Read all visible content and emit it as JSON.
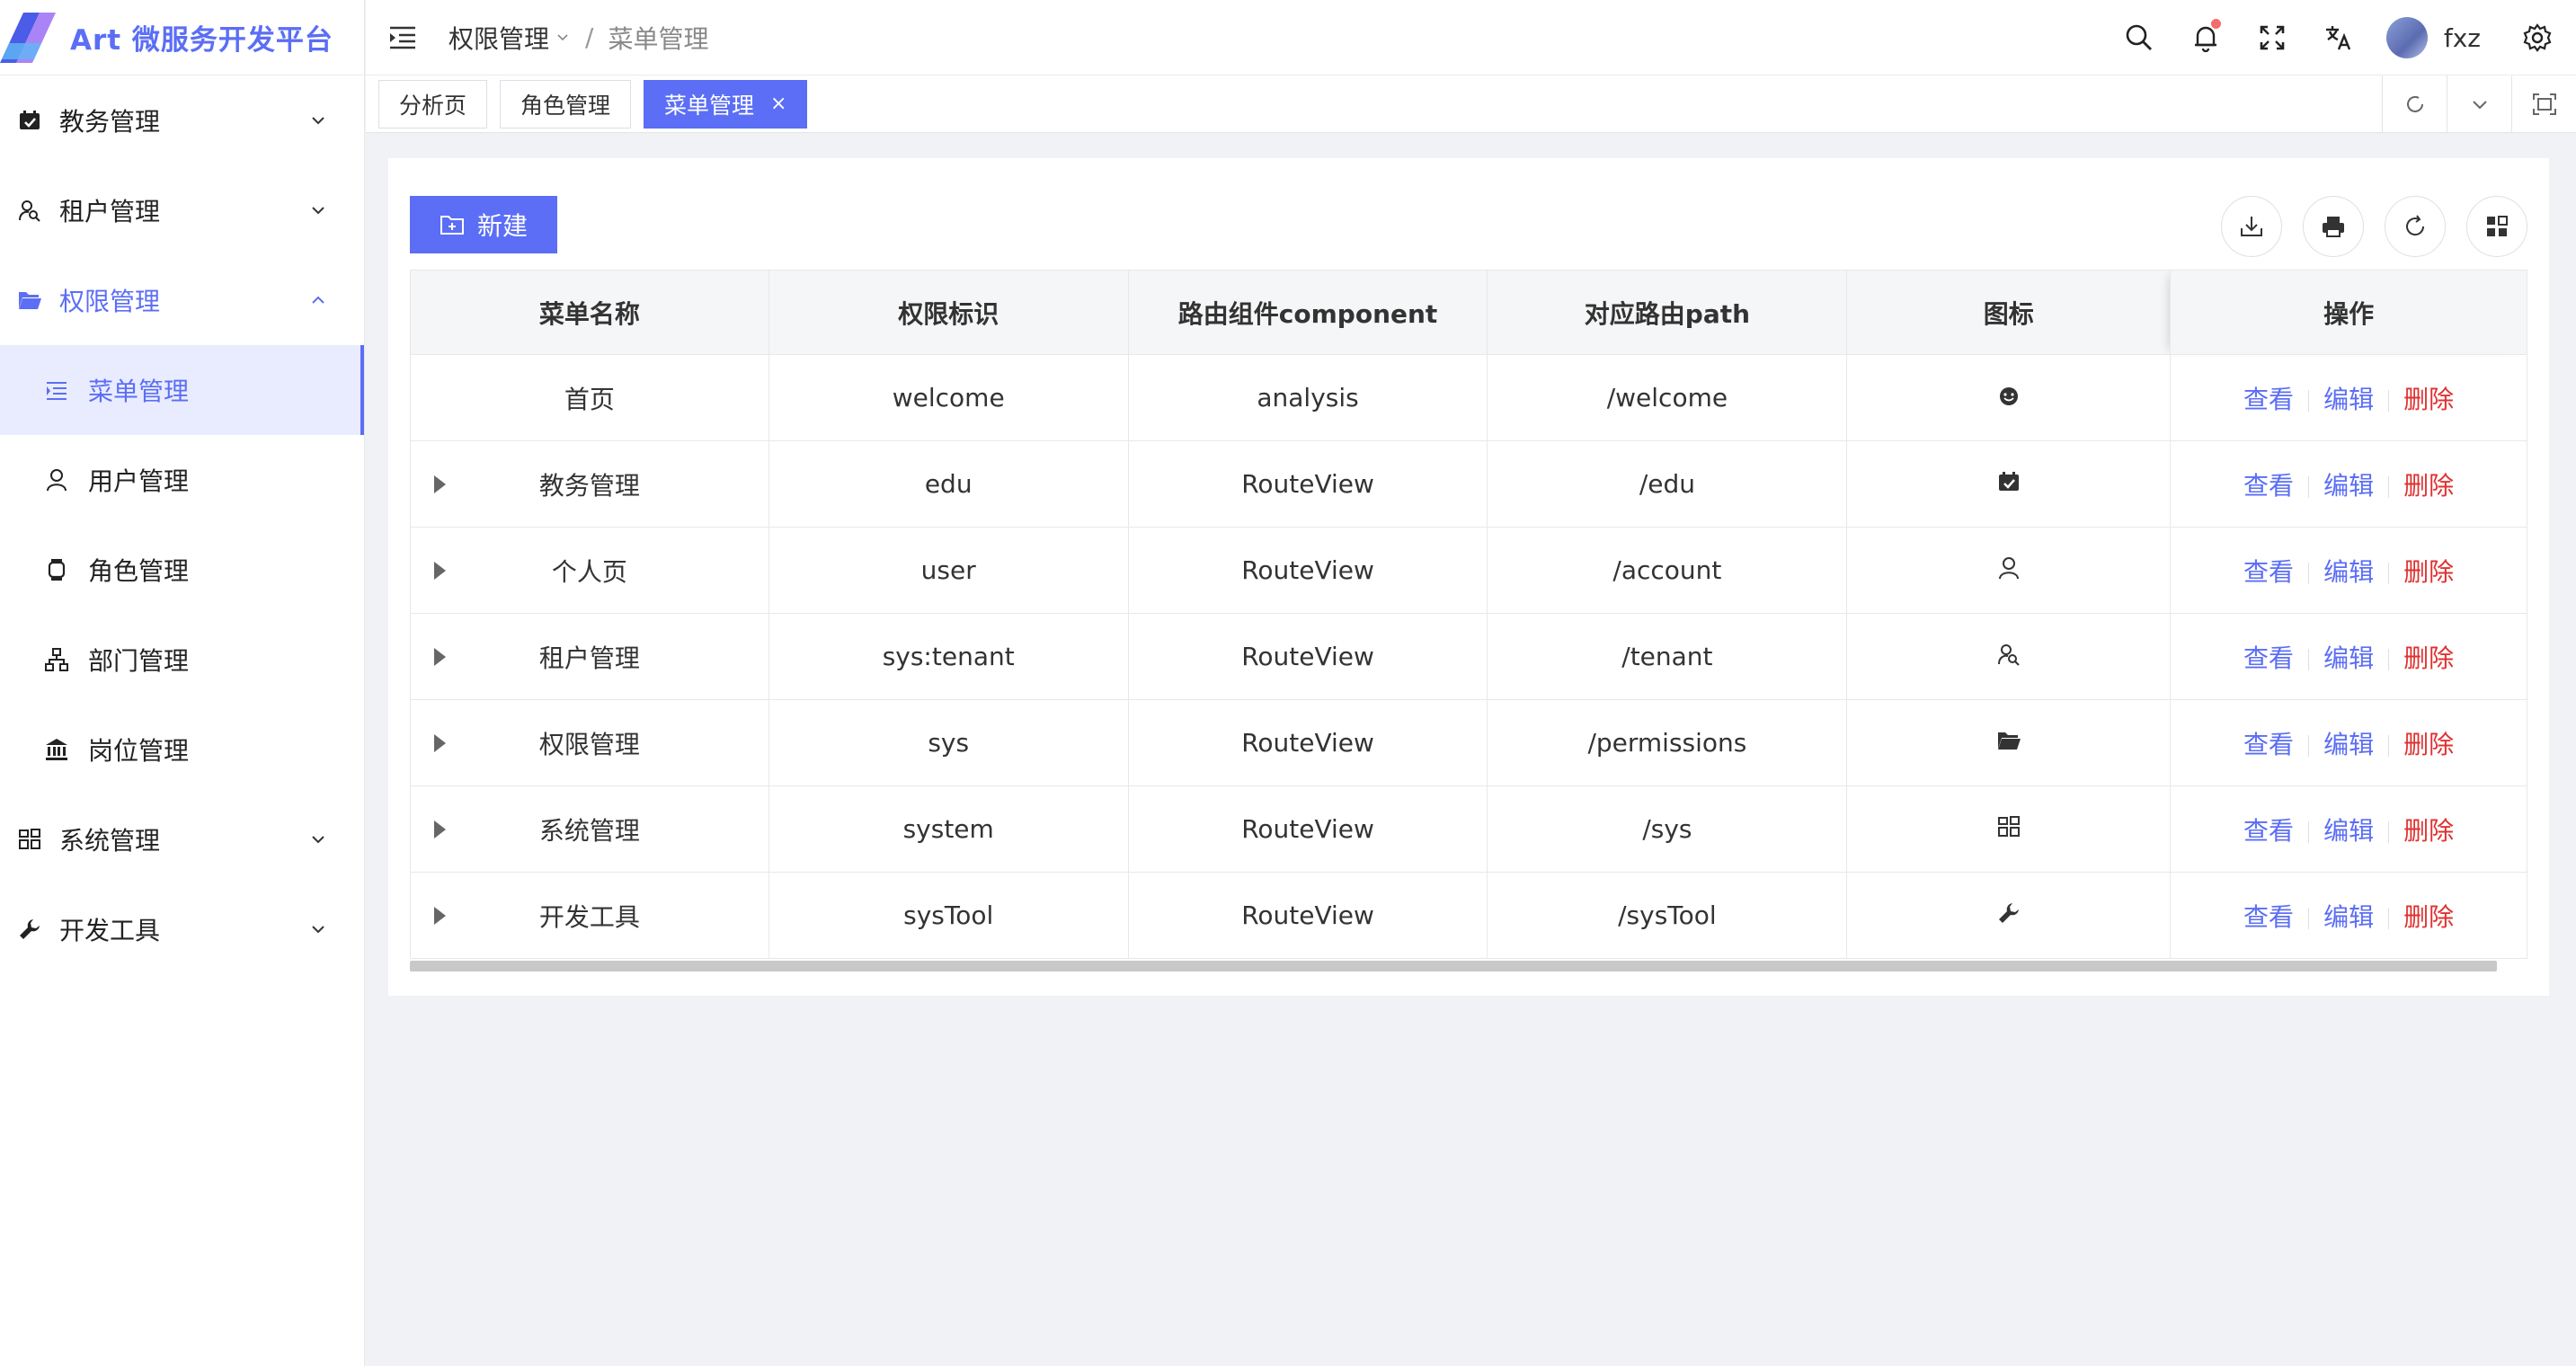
{
  "app": {
    "title": "Art 微服务开发平台",
    "accent": "#5b6ef5"
  },
  "sidebar": {
    "items": [
      {
        "label": "教务管理",
        "icon": "calendar-check-icon"
      },
      {
        "label": "租户管理",
        "icon": "user-search-icon"
      },
      {
        "label": "权限管理",
        "icon": "folder-open-icon",
        "expanded": true
      },
      {
        "label": "系统管理",
        "icon": "appstore-icon"
      },
      {
        "label": "开发工具",
        "icon": "wrench-icon"
      }
    ],
    "sub_items": [
      {
        "label": "菜单管理",
        "icon": "menu-list-icon",
        "active": true
      },
      {
        "label": "用户管理",
        "icon": "user-icon"
      },
      {
        "label": "角色管理",
        "icon": "watch-icon"
      },
      {
        "label": "部门管理",
        "icon": "org-tree-icon"
      },
      {
        "label": "岗位管理",
        "icon": "bank-icon"
      }
    ]
  },
  "header": {
    "breadcrumb": [
      "权限管理",
      "菜单管理"
    ],
    "separator": "/",
    "username": "fxz"
  },
  "tabs": [
    {
      "label": "分析页"
    },
    {
      "label": "角色管理"
    },
    {
      "label": "菜单管理",
      "active": true,
      "close": "×"
    }
  ],
  "toolbar": {
    "new_label": "新建"
  },
  "table": {
    "columns": [
      "菜单名称",
      "权限标识",
      "路由组件component",
      "对应路由path",
      "图标",
      "操作"
    ],
    "rows": [
      {
        "name": "首页",
        "perm": "welcome",
        "component": "analysis",
        "path": "/welcome",
        "icon": "smile-icon",
        "expandable": false
      },
      {
        "name": "教务管理",
        "perm": "edu",
        "component": "RouteView",
        "path": "/edu",
        "icon": "calendar-check-icon",
        "expandable": true
      },
      {
        "name": "个人页",
        "perm": "user",
        "component": "RouteView",
        "path": "/account",
        "icon": "user-icon",
        "expandable": true
      },
      {
        "name": "租户管理",
        "perm": "sys:tenant",
        "component": "RouteView",
        "path": "/tenant",
        "icon": "user-search-icon",
        "expandable": true
      },
      {
        "name": "权限管理",
        "perm": "sys",
        "component": "RouteView",
        "path": "/permissions",
        "icon": "folder-open-icon",
        "expandable": true
      },
      {
        "name": "系统管理",
        "perm": "system",
        "component": "RouteView",
        "path": "/sys",
        "icon": "appstore-icon",
        "expandable": true
      },
      {
        "name": "开发工具",
        "perm": "sysTool",
        "component": "RouteView",
        "path": "/sysTool",
        "icon": "wrench-icon",
        "expandable": true
      }
    ],
    "actions": {
      "view": "查看",
      "edit": "编辑",
      "delete": "删除"
    }
  }
}
